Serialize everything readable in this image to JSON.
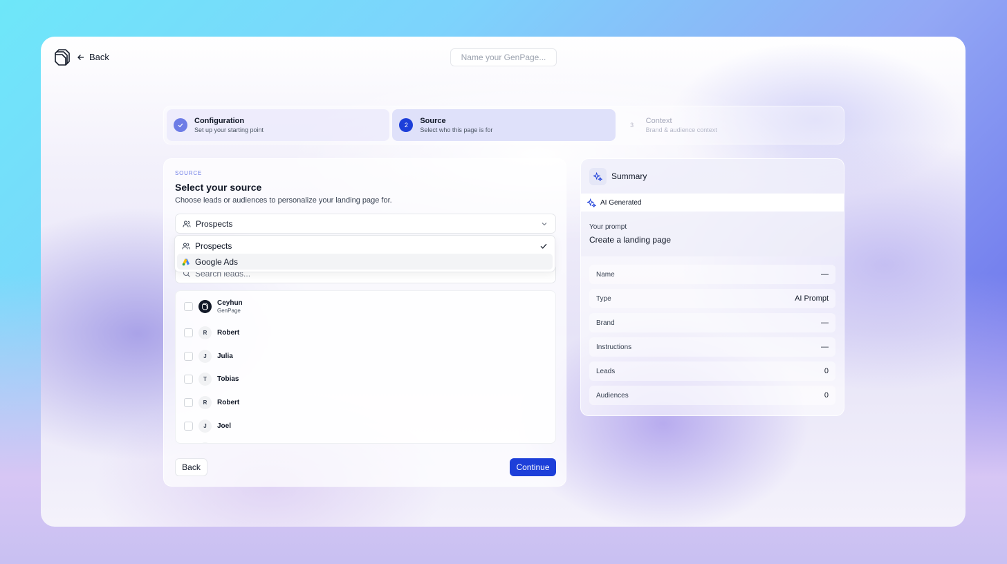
{
  "topbar": {
    "back_label": "Back",
    "page_name_placeholder": "Name your GenPage..."
  },
  "steps": [
    {
      "number": "✓",
      "title": "Configuration",
      "subtitle": "Set up your starting point",
      "state": "done"
    },
    {
      "number": "2",
      "title": "Source",
      "subtitle": "Select who this page is for",
      "state": "active"
    },
    {
      "number": "3",
      "title": "Context",
      "subtitle": "Brand & audience context",
      "state": "pending"
    }
  ],
  "source": {
    "eyebrow": "SOURCE",
    "title": "Select your source",
    "description": "Choose leads or audiences to personalize your landing page for.",
    "selected": "Prospects",
    "dropdown_options": [
      {
        "label": "Prospects",
        "icon": "users-icon",
        "selected": true
      },
      {
        "label": "Google Ads",
        "icon": "google-ads-icon",
        "selected": false
      }
    ],
    "search_placeholder": "Search leads...",
    "leads": [
      {
        "name": "Ceyhun",
        "company": "GenPage",
        "initial": ""
      },
      {
        "name": "Robert",
        "company": "",
        "initial": "R"
      },
      {
        "name": "Julia",
        "company": "",
        "initial": "J"
      },
      {
        "name": "Tobias",
        "company": "",
        "initial": "T"
      },
      {
        "name": "Robert",
        "company": "",
        "initial": "R"
      },
      {
        "name": "Joel",
        "company": "",
        "initial": "J"
      }
    ],
    "back_label": "Back",
    "continue_label": "Continue"
  },
  "summary": {
    "title": "Summary",
    "ai_badge": "AI Generated",
    "prompt_label": "Your prompt",
    "prompt_value": "Create a landing page",
    "fields": [
      {
        "label": "Name",
        "value": "—"
      },
      {
        "label": "Type",
        "value": "AI Prompt"
      },
      {
        "label": "Brand",
        "value": "—"
      },
      {
        "label": "Instructions",
        "value": "—"
      },
      {
        "label": "Leads",
        "value": "0"
      },
      {
        "label": "Audiences",
        "value": "0"
      }
    ]
  },
  "colors": {
    "accent": "#1d3fd9",
    "step_done": "#6d7ce6"
  }
}
